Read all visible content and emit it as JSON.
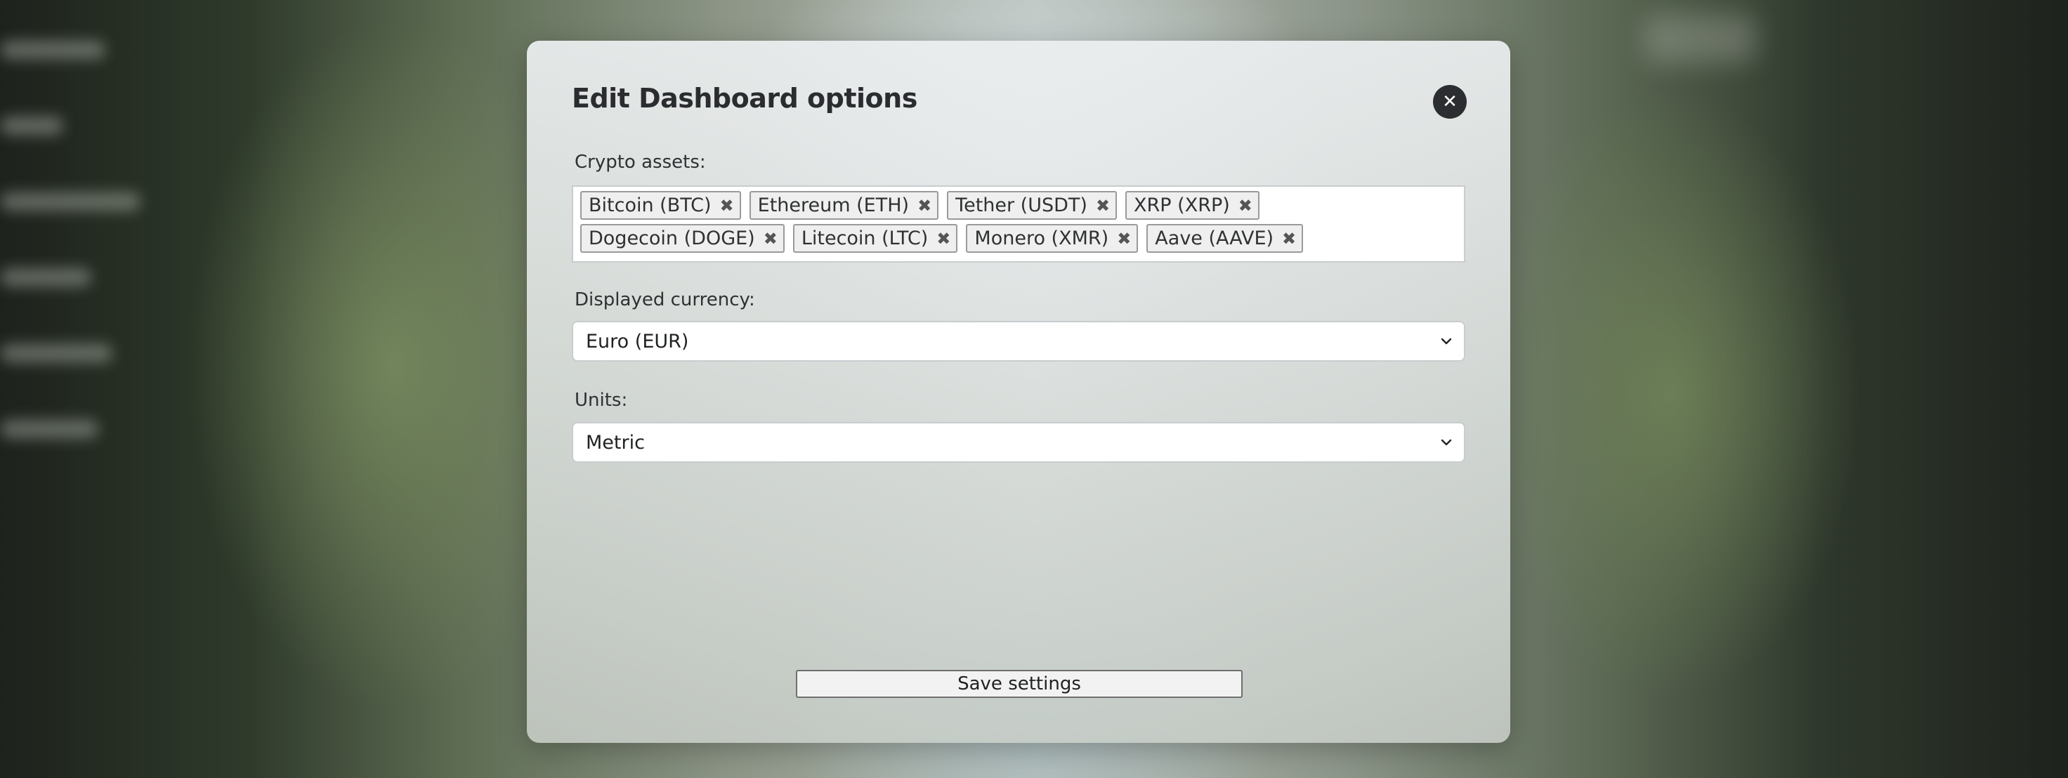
{
  "dialog": {
    "title": "Edit Dashboard options",
    "close_icon": "close-icon"
  },
  "crypto": {
    "label": "Crypto assets:",
    "tags": [
      {
        "label": "Bitcoin (BTC)",
        "remove_icon": "✖"
      },
      {
        "label": "Ethereum (ETH)",
        "remove_icon": "✖"
      },
      {
        "label": "Tether (USDT)",
        "remove_icon": "✖"
      },
      {
        "label": "XRP (XRP)",
        "remove_icon": "✖"
      },
      {
        "label": "Dogecoin (DOGE)",
        "remove_icon": "✖"
      },
      {
        "label": "Litecoin (LTC)",
        "remove_icon": "✖"
      },
      {
        "label": "Monero (XMR)",
        "remove_icon": "✖"
      },
      {
        "label": "Aave (AAVE)",
        "remove_icon": "✖"
      }
    ]
  },
  "currency": {
    "label": "Displayed currency:",
    "selected": "Euro (EUR)"
  },
  "units": {
    "label": "Units:",
    "selected": "Metric"
  },
  "save_label": "Save settings",
  "close_glyph": "✕"
}
